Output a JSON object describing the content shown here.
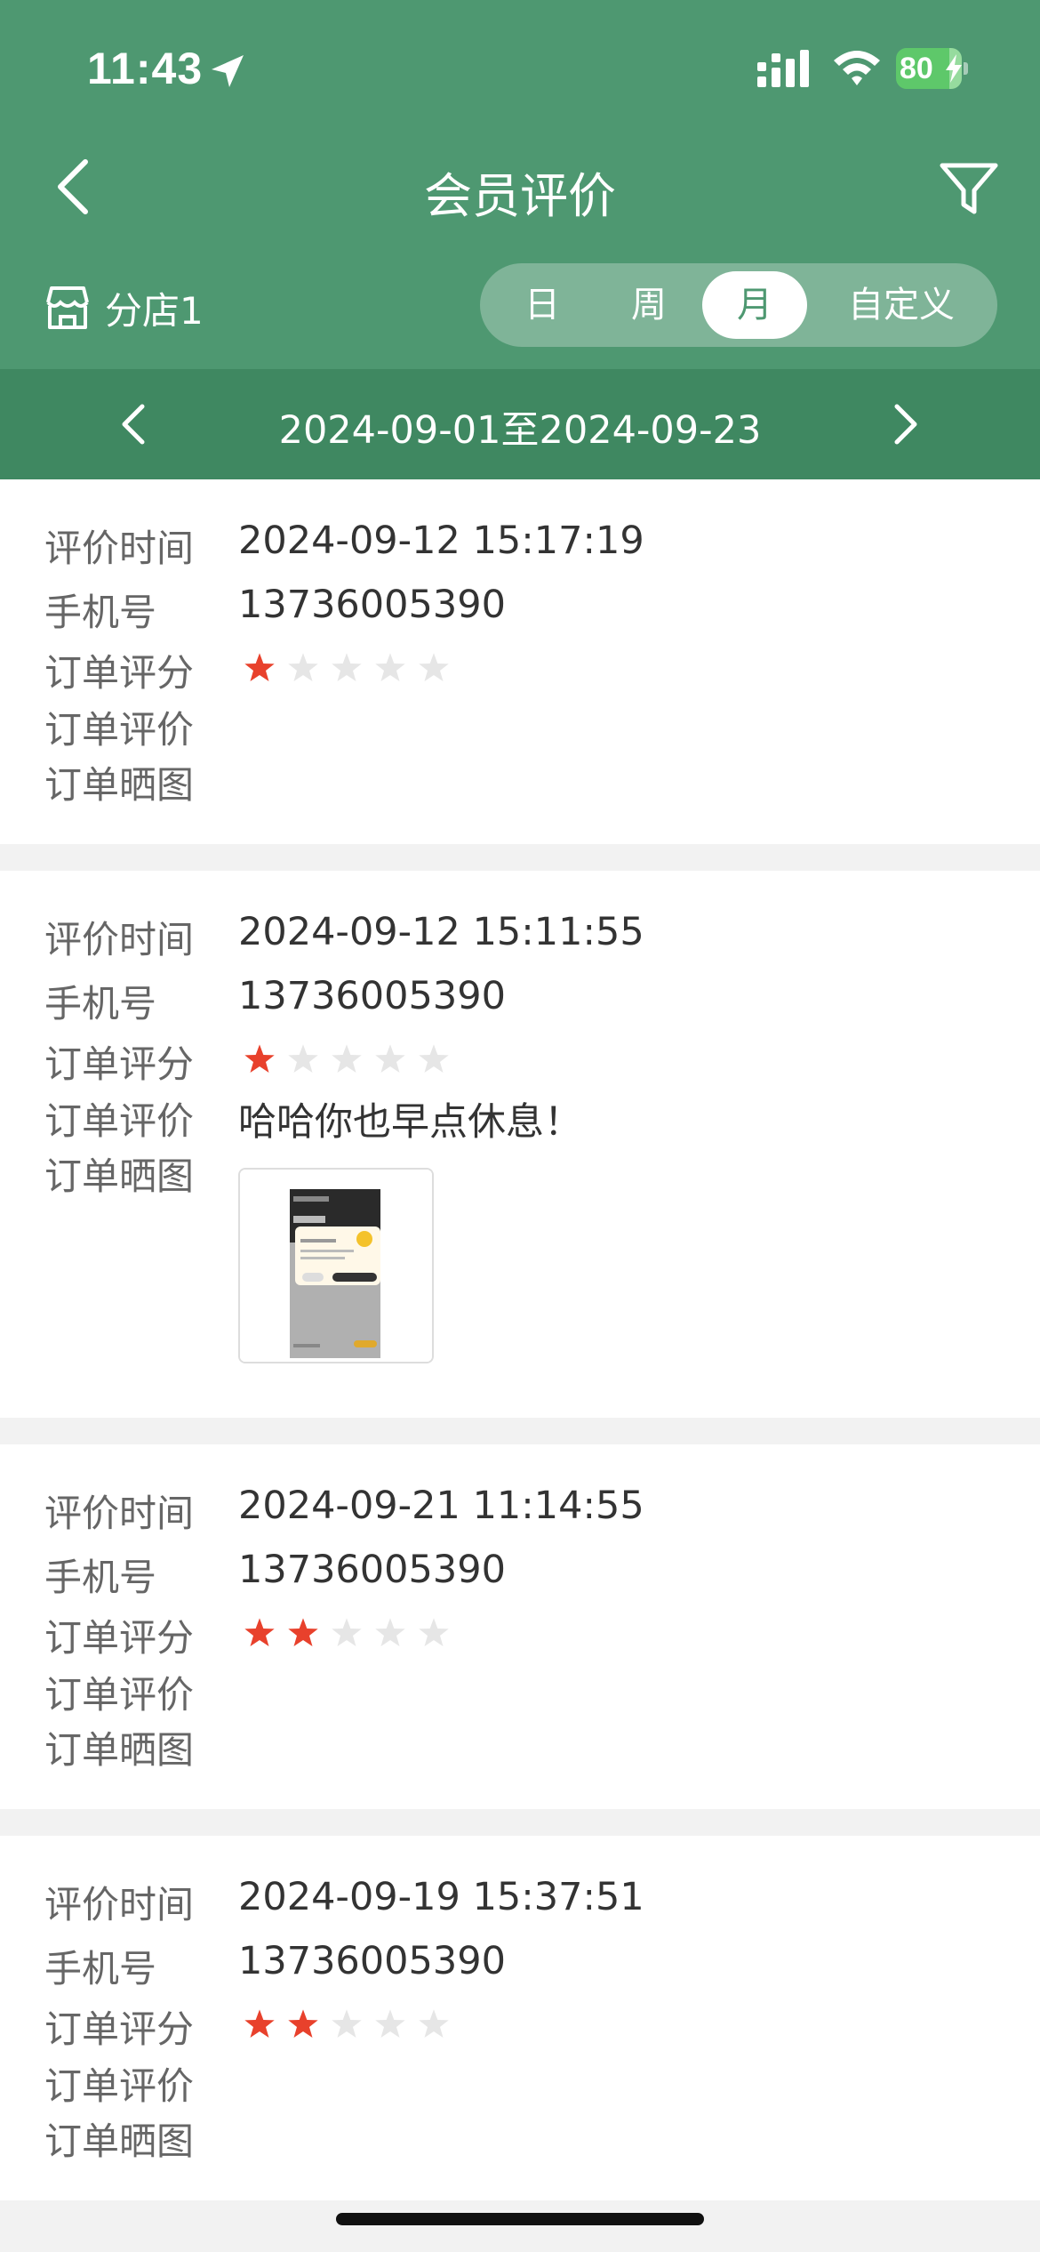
{
  "status_bar": {
    "time": "11:43",
    "battery": "80"
  },
  "nav": {
    "title": "会员评价"
  },
  "store": {
    "name": "分店1"
  },
  "period_tabs": [
    {
      "label": "日",
      "active": false
    },
    {
      "label": "周",
      "active": false
    },
    {
      "label": "月",
      "active": true
    },
    {
      "label": "自定义",
      "active": false
    }
  ],
  "date_range": "2024-09-01至2024-09-23",
  "labels": {
    "time": "评价时间",
    "phone": "手机号",
    "score": "订单评分",
    "comment": "订单评价",
    "photos": "订单晒图"
  },
  "reviews": [
    {
      "time": "2024-09-12 15:17:19",
      "phone": "13736005390",
      "rating": 1,
      "comment": "",
      "has_photo": false
    },
    {
      "time": "2024-09-12 15:11:55",
      "phone": "13736005390",
      "rating": 1,
      "comment": "哈哈你也早点休息！",
      "has_photo": true
    },
    {
      "time": "2024-09-21 11:14:55",
      "phone": "13736005390",
      "rating": 2,
      "comment": "",
      "has_photo": false
    },
    {
      "time": "2024-09-19 15:37:51",
      "phone": "13736005390",
      "rating": 2,
      "comment": "",
      "has_photo": false
    }
  ],
  "colors": {
    "header": "#4e9871",
    "date_bar": "#3f8861",
    "star_on": "#e8412c",
    "star_off": "#e6e6e6"
  }
}
